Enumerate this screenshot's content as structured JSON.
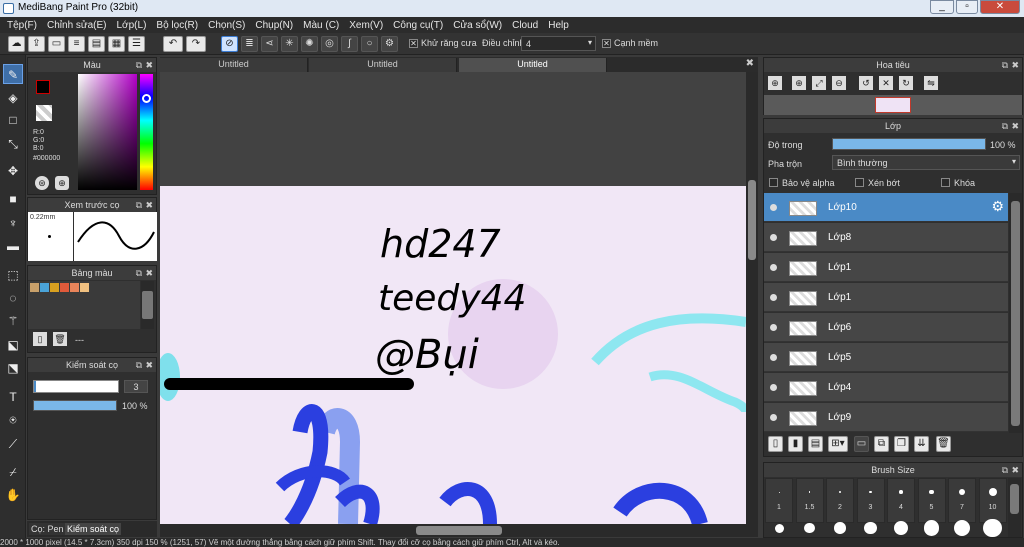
{
  "window": {
    "title": "MediBang Paint Pro (32bit)",
    "controls": [
      "_",
      "▫",
      "✕"
    ]
  },
  "menu": [
    "Tệp(F)",
    "Chỉnh sửa(E)",
    "Lớp(L)",
    "Bộ lọc(R)",
    "Chọn(S)",
    "Chụp(N)",
    "Màu (C)",
    "Xem(V)",
    "Công cụ(T)",
    "Cửa sổ(W)",
    "Cloud",
    "Help"
  ],
  "toolbar": {
    "antialias_label": "Khử răng cưa",
    "adjust_label": "Điều chỉnh",
    "adjust_value": "4",
    "edge_label": "Cạnh mềm"
  },
  "color_panel": {
    "title": "Màu",
    "r": "R:0",
    "g": "G:0",
    "b": "B:0",
    "hex": "#000000"
  },
  "brush_preview": {
    "title": "Xem trước cọ",
    "size": "0.22mm"
  },
  "palette": {
    "title": "Bảng màu",
    "swatches": [
      "#c8a06a",
      "#4aa3d8",
      "#d8a020",
      "#e05a3a",
      "#e8845a",
      "#f0c080"
    ],
    "extra": "---"
  },
  "brush_control": {
    "title": "Kiểm soát cọ",
    "size_value": "3",
    "opacity_value": "100 %",
    "opacity": 1.0
  },
  "bottom_tabs": [
    "Cọ: Pen",
    "Kiểm soát cọ"
  ],
  "tabs": [
    "Untitled",
    "Untitled",
    "Untitled"
  ],
  "canvas": {
    "lines": [
      "hd247",
      "teedy44",
      "@Bụi"
    ]
  },
  "navigator": {
    "title": "Hoa tiêu"
  },
  "layer_panel": {
    "title": "Lớp",
    "opacity_label": "Độ trong",
    "opacity_value": "100 %",
    "opacity": 1.0,
    "blend_label": "Pha trộn",
    "blend_value": "Bình thường",
    "protect_alpha": "Bảo vệ alpha",
    "clipping": "Xén bớt",
    "lock": "Khóa",
    "layers": [
      "Lớp10",
      "Lớp8",
      "Lớp1",
      "Lớp1",
      "Lớp6",
      "Lớp5",
      "Lớp4",
      "Lớp9"
    ]
  },
  "brush_size": {
    "title": "Brush Size",
    "labels": [
      "1",
      "1.5",
      "2",
      "3",
      "4",
      "5",
      "7",
      "10"
    ]
  },
  "status": "2000 * 1000 pixel (14.5 * 7.3cm) 350 dpi 150 % (1251, 57) Vẽ một đường thẳng bằng cách giữ phím Shift. Thay đổi cỡ cọ bằng cách giữ phím Ctrl, Alt và kéo."
}
